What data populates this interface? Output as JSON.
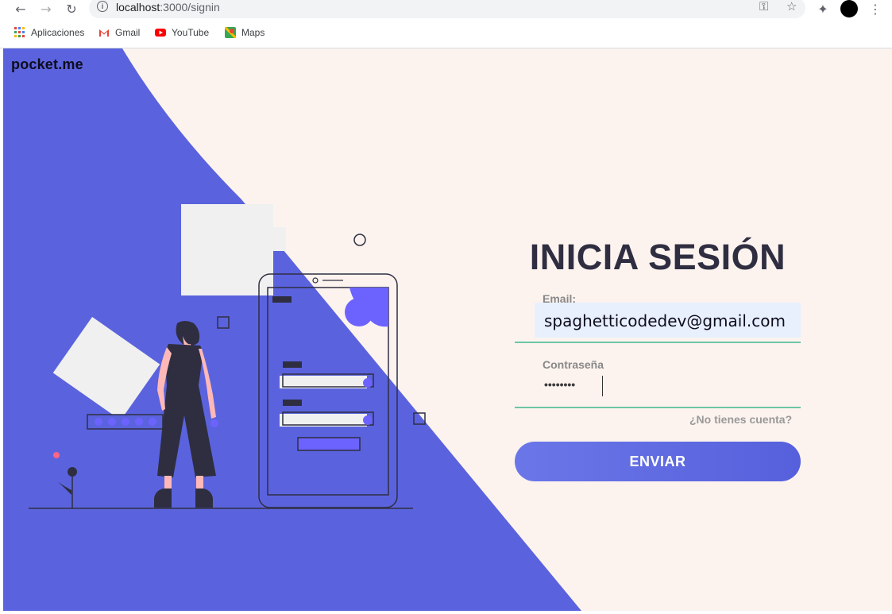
{
  "browser": {
    "url_host": "localhost",
    "url_path": ":3000/signin",
    "bookmarks": [
      {
        "label": "Aplicaciones",
        "icon": "apps-grid-icon"
      },
      {
        "label": "Gmail",
        "icon": "gmail-icon"
      },
      {
        "label": "YouTube",
        "icon": "youtube-icon"
      },
      {
        "label": "Maps",
        "icon": "maps-icon"
      }
    ]
  },
  "page": {
    "logo": "pocket.me",
    "title": "INICIA SESIÓN",
    "email_label": "Email:",
    "email_value": "spaghetticodedev@gmail.com",
    "password_label": "Contraseña",
    "password_mask": "••••••••",
    "signup_link": "¿No tienes cuenta?",
    "submit_label": "ENVIAR"
  },
  "colors": {
    "accent": "#5a63dd",
    "background": "#fcf3ef",
    "input_underline": "#6dc5a5",
    "autofill": "#e8f0fe",
    "text_dark": "#2f2e41"
  }
}
